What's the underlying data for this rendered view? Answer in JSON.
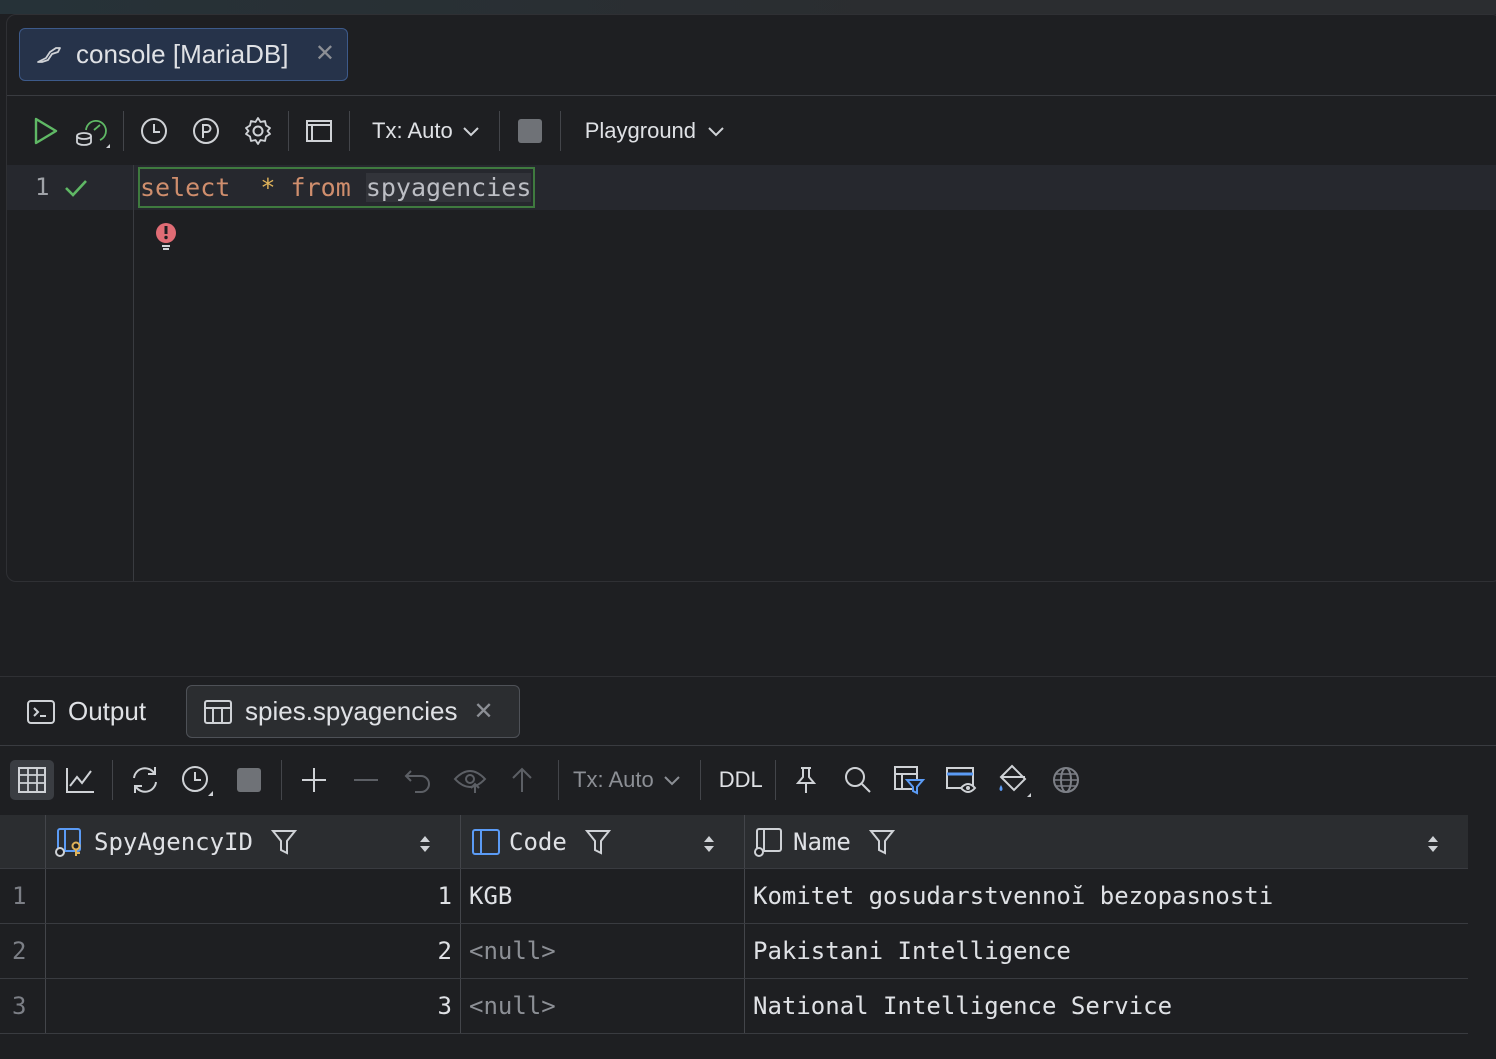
{
  "editor": {
    "tab": {
      "icon": "console-icon",
      "label": "console [MariaDB]"
    },
    "toolbar": {
      "tx_label": "Tx: Auto",
      "playground_label": "Playground"
    },
    "line_number": "1",
    "query": {
      "select": "select",
      "star": "*",
      "from": "from",
      "table": "spyagencies"
    }
  },
  "results": {
    "tabs": [
      {
        "label": "Output"
      },
      {
        "label": "spies.spyagencies"
      }
    ],
    "toolbar": {
      "tx_label": "Tx: Auto",
      "ddl_label": "DDL"
    },
    "columns": [
      "SpyAgencyID",
      "Code",
      "Name"
    ],
    "rows": [
      {
        "n": "1",
        "id": "1",
        "code": "KGB",
        "name": "Komitet gosudarstvennoĭ bezopasnosti"
      },
      {
        "n": "2",
        "id": "2",
        "code": "<null>",
        "name": "Pakistani Intelligence"
      },
      {
        "n": "3",
        "id": "3",
        "code": "<null>",
        "name": "National Intelligence Service"
      }
    ]
  },
  "colors": {
    "accent_green": "#5fb865",
    "keyword": "#cf8e6d",
    "error": "#e06c75"
  }
}
